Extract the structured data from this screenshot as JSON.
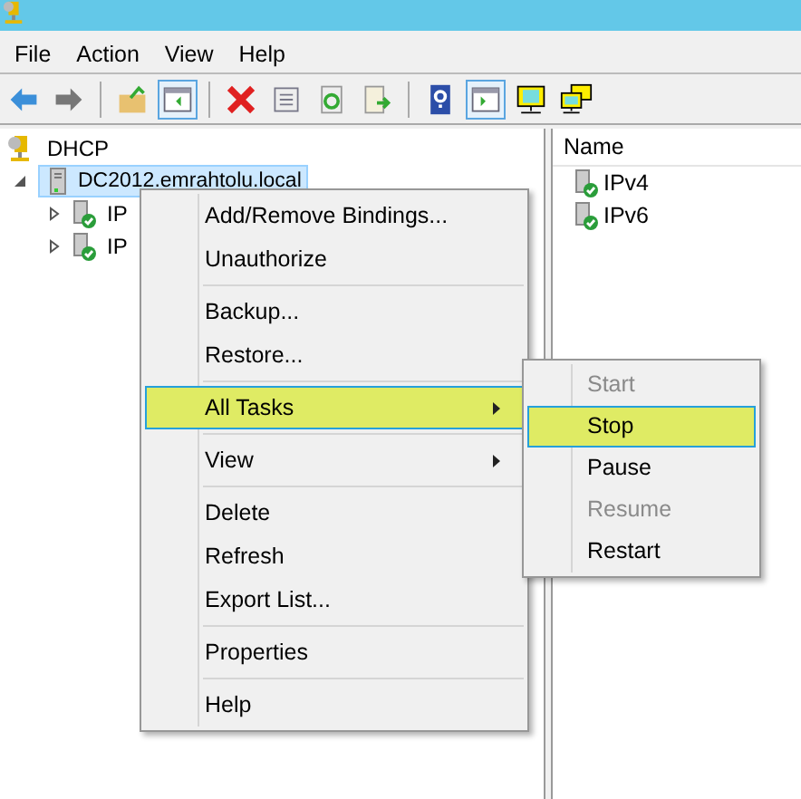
{
  "menu_bar": [
    "File",
    "Action",
    "View",
    "Help"
  ],
  "toolbar": [
    {
      "kind": "back",
      "pressed": false
    },
    {
      "kind": "forward",
      "pressed": false
    },
    {
      "kind": "sep",
      "pressed": false
    },
    {
      "kind": "up",
      "pressed": false
    },
    {
      "kind": "tree",
      "pressed": true
    },
    {
      "kind": "sep",
      "pressed": false
    },
    {
      "kind": "delete",
      "pressed": false
    },
    {
      "kind": "props",
      "pressed": false
    },
    {
      "kind": "refresh",
      "pressed": false
    },
    {
      "kind": "export",
      "pressed": false
    },
    {
      "kind": "sep",
      "pressed": false
    },
    {
      "kind": "help",
      "pressed": false
    },
    {
      "kind": "action",
      "pressed": true
    },
    {
      "kind": "monitor",
      "pressed": false
    },
    {
      "kind": "monitors",
      "pressed": false
    }
  ],
  "tree": {
    "label": "DHCP",
    "children": [
      {
        "label": "DC2012.emrahtolu.local",
        "expanded": true,
        "selected": true,
        "children": [
          {
            "label": "IP",
            "expanded": false,
            "selected": false
          },
          {
            "label": "IP",
            "expanded": false,
            "selected": false
          }
        ]
      }
    ]
  },
  "list": {
    "column": "Name",
    "rows": [
      "IPv4",
      "IPv6"
    ]
  },
  "context_menu": [
    {
      "kind": "item",
      "label": "Add/Remove Bindings...",
      "selected": false,
      "submenu": false
    },
    {
      "kind": "item",
      "label": "Unauthorize",
      "selected": false,
      "submenu": false
    },
    {
      "kind": "sep"
    },
    {
      "kind": "item",
      "label": "Backup...",
      "selected": false,
      "submenu": false
    },
    {
      "kind": "item",
      "label": "Restore...",
      "selected": false,
      "submenu": false
    },
    {
      "kind": "sep"
    },
    {
      "kind": "item",
      "label": "All Tasks",
      "selected": true,
      "submenu": true
    },
    {
      "kind": "sep"
    },
    {
      "kind": "item",
      "label": "View",
      "selected": false,
      "submenu": true
    },
    {
      "kind": "sep"
    },
    {
      "kind": "item",
      "label": "Delete",
      "selected": false,
      "submenu": false
    },
    {
      "kind": "item",
      "label": "Refresh",
      "selected": false,
      "submenu": false
    },
    {
      "kind": "item",
      "label": "Export List...",
      "selected": false,
      "submenu": false
    },
    {
      "kind": "sep"
    },
    {
      "kind": "item",
      "label": "Properties",
      "selected": false,
      "submenu": false
    },
    {
      "kind": "sep"
    },
    {
      "kind": "item",
      "label": "Help",
      "selected": false,
      "submenu": false
    }
  ],
  "submenu": [
    {
      "label": "Start",
      "disabled": true,
      "selected": false
    },
    {
      "label": "Stop",
      "disabled": false,
      "selected": true
    },
    {
      "label": "Pause",
      "disabled": false,
      "selected": false
    },
    {
      "label": "Resume",
      "disabled": true,
      "selected": false
    },
    {
      "label": "Restart",
      "disabled": false,
      "selected": false
    }
  ]
}
